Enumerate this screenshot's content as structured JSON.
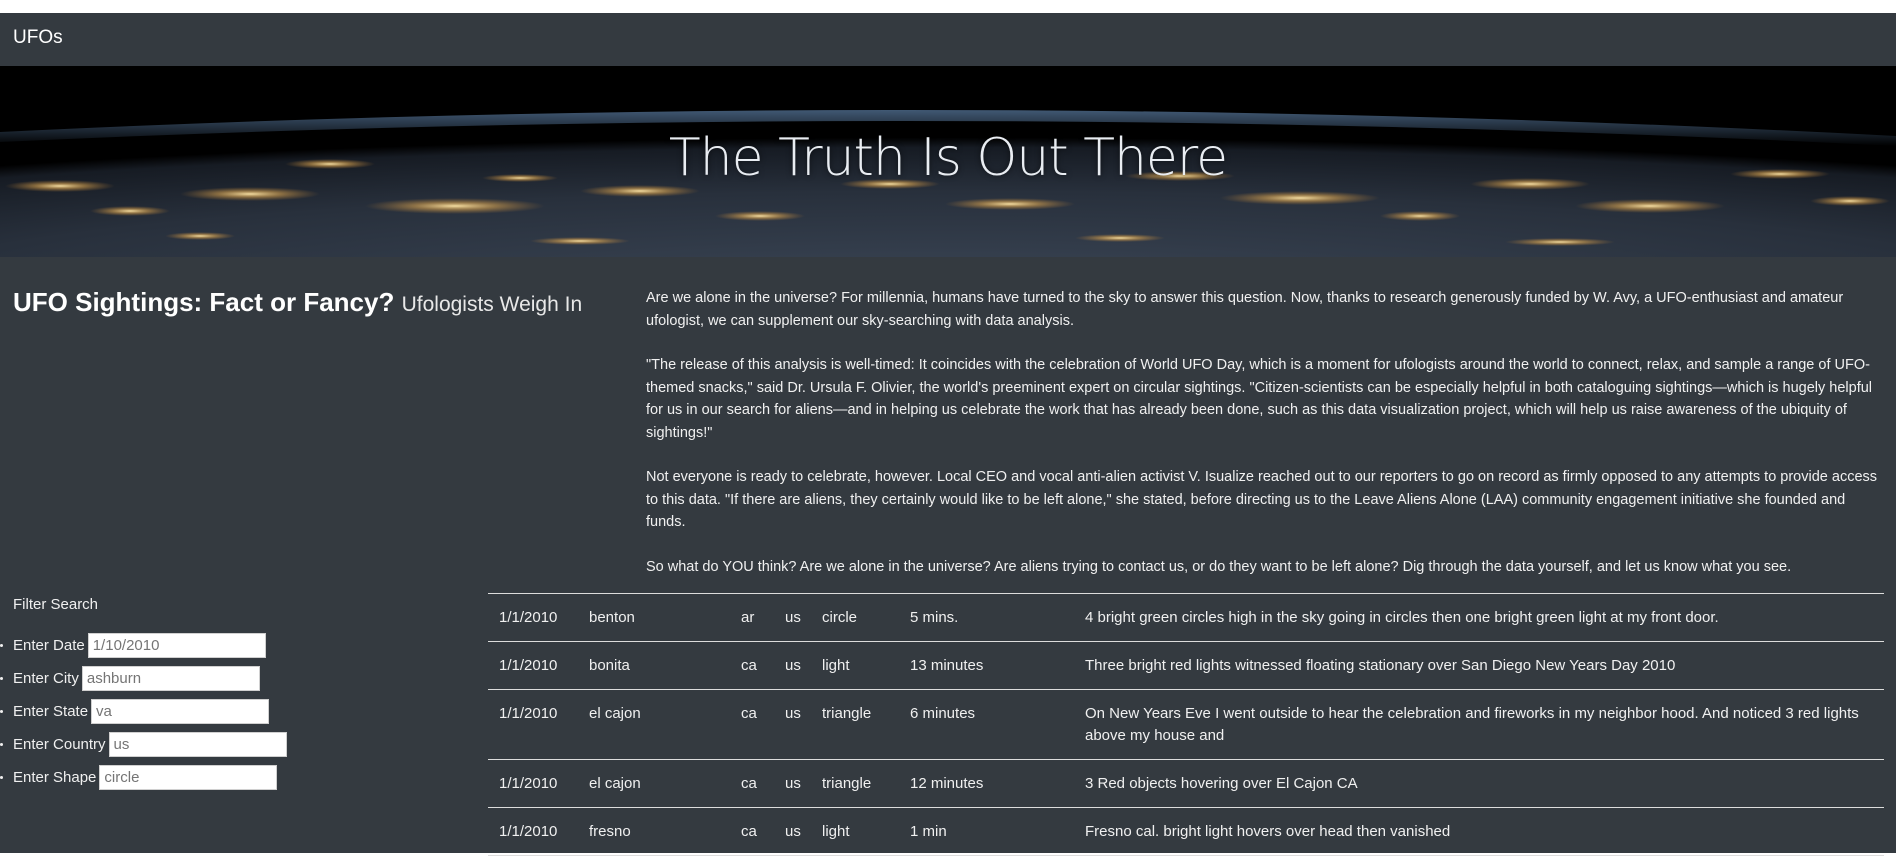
{
  "navbar": {
    "brand": "UFOs"
  },
  "hero": {
    "title": "The Truth Is Out There"
  },
  "headline": {
    "title": "UFO Sightings: Fact or Fancy?",
    "subtitle": "Ufologists Weigh In"
  },
  "article": {
    "paragraphs": [
      "Are we alone in the universe? For millennia, humans have turned to the sky to answer this question. Now, thanks to research generously funded by W. Avy, a UFO-enthusiast and amateur ufologist, we can supplement our sky-searching with data analysis.",
      "\"The release of this analysis is well-timed: It coincides with the celebration of World UFO Day, which is a moment for ufologists around the world to connect, relax, and sample a range of UFO-themed snacks,\" said Dr. Ursula F. Olivier, the world's preeminent expert on circular sightings. \"Citizen-scientists can be especially helpful in both cataloguing sightings—which is hugely helpful for us in our search for aliens—and in helping us celebrate the work that has already been done, such as this data visualization project, which will help us raise awareness of the ubiquity of sightings!\"",
      "Not everyone is ready to celebrate, however. Local CEO and vocal anti-alien activist V. Isualize reached out to our reporters to go on record as firmly opposed to any attempts to provide access to this data. \"If there are aliens, they certainly would like to be left alone,\" she stated, before directing us to the Leave Aliens Alone (LAA) community engagement initiative she founded and funds.",
      "So what do YOU think? Are we alone in the universe? Are aliens trying to contact us, or do they want to be left alone? Dig through the data yourself, and let us know what you see."
    ]
  },
  "filters": {
    "heading": "Filter Search",
    "items": [
      {
        "label": "Enter Date",
        "placeholder": "1/10/2010"
      },
      {
        "label": "Enter City",
        "placeholder": "ashburn"
      },
      {
        "label": "Enter State",
        "placeholder": "va"
      },
      {
        "label": "Enter Country",
        "placeholder": "us"
      },
      {
        "label": "Enter Shape",
        "placeholder": "circle"
      }
    ]
  },
  "table": {
    "rows": [
      [
        "1/1/2010",
        "benton",
        "ar",
        "us",
        "circle",
        "5 mins.",
        "4 bright green circles high in the sky going in circles then one bright green light at my front door."
      ],
      [
        "1/1/2010",
        "bonita",
        "ca",
        "us",
        "light",
        "13 minutes",
        "Three bright red lights witnessed floating stationary over San Diego New Years Day 2010"
      ],
      [
        "1/1/2010",
        "el cajon",
        "ca",
        "us",
        "triangle",
        "6 minutes",
        "On New Years Eve I went outside to hear the celebration and fireworks in my neighbor hood. And noticed 3 red lights above my house and"
      ],
      [
        "1/1/2010",
        "el cajon",
        "ca",
        "us",
        "triangle",
        "12 minutes",
        "3 Red objects hovering over El Cajon CA"
      ],
      [
        "1/1/2010",
        "fresno",
        "ca",
        "us",
        "light",
        "1 min",
        "Fresno cal. bright light hovers over head then vanished"
      ]
    ]
  }
}
